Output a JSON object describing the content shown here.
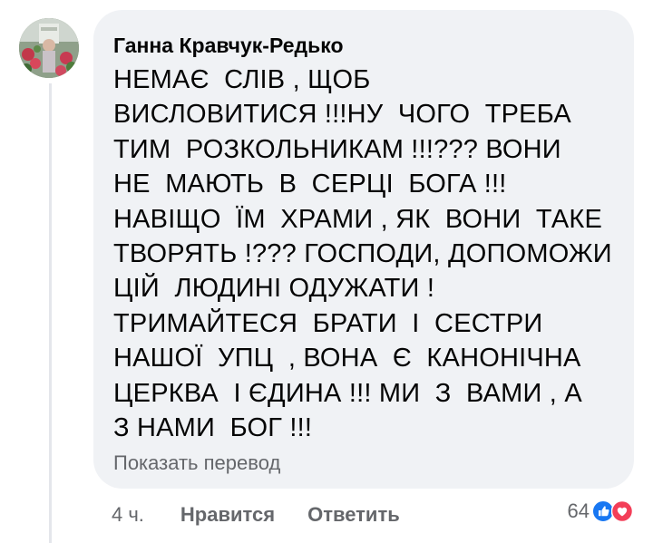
{
  "comment": {
    "author": "Ганна Кравчук-Редько",
    "lines": [
      "НЕМАЄ  СЛІВ , ЩОБ",
      "ВИСЛОВИТИСЯ !!!НУ  ЧОГО  ТРЕБА",
      "ТИМ  РОЗКОЛЬНИКАМ !!!??? ВОНИ",
      "НЕ  МАЮТЬ  В  СЕРЦІ  БОГА !!!",
      "НАВІЩО  ЇМ  ХРАМИ , ЯК  ВОНИ  ТАКЕ",
      "ТВОРЯТЬ !??? ГОСПОДИ, ДОПОМОЖИ",
      "ЦІЙ  ЛЮДИНІ ОДУЖАТИ !",
      "ТРИМАЙТЕСЯ  БРАТИ  І  СЕСТРИ",
      "НАШОЇ  УПЦ  , ВОНА  Є  КАНОНІЧНА",
      "ЦЕРКВА  І ЄДИНА !!! МИ  З  ВАМИ , А",
      "З НАМИ  БОГ !!!"
    ],
    "translate_label": "Показать перевод",
    "time": "4 ч.",
    "like_label": "Нравится",
    "reply_label": "Ответить",
    "reaction_count": "64"
  },
  "colors": {
    "bubble": "#f0f2f5",
    "text": "#050505",
    "secondary": "#65676b",
    "like_blue": "#1877f2",
    "love_red": "#f33e58"
  },
  "icons": {
    "avatar": "profile-photo-flowers",
    "reaction_1": "like-icon",
    "reaction_2": "love-icon"
  }
}
